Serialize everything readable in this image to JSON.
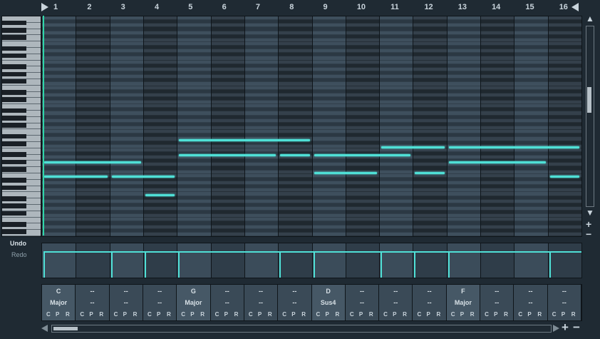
{
  "colors": {
    "accent": "#4fe0d6",
    "background": "#1f2a33",
    "text": "#c9d4dc"
  },
  "ruler": {
    "bars": [
      "1",
      "2",
      "3",
      "4",
      "5",
      "6",
      "7",
      "8",
      "9",
      "10",
      "11",
      "12",
      "13",
      "14",
      "15",
      "16"
    ],
    "start_marker_icon": "play-right-triangle-icon",
    "end_marker_icon": "play-left-triangle-icon"
  },
  "history": {
    "undo_label": "Undo",
    "redo_label": "Redo"
  },
  "notes": [
    {
      "bar": 1,
      "length": 3,
      "pitch": 20
    },
    {
      "bar": 1,
      "length": 2,
      "pitch": 16
    },
    {
      "bar": 3,
      "length": 2,
      "pitch": 16
    },
    {
      "bar": 4,
      "length": 1,
      "pitch": 11
    },
    {
      "bar": 5,
      "length": 4,
      "pitch": 26
    },
    {
      "bar": 5,
      "length": 3,
      "pitch": 22
    },
    {
      "bar": 8,
      "length": 1,
      "pitch": 22
    },
    {
      "bar": 9,
      "length": 3,
      "pitch": 22
    },
    {
      "bar": 9,
      "length": 2,
      "pitch": 17
    },
    {
      "bar": 11,
      "length": 2,
      "pitch": 24
    },
    {
      "bar": 12,
      "length": 1,
      "pitch": 17
    },
    {
      "bar": 13,
      "length": 4,
      "pitch": 24
    },
    {
      "bar": 13,
      "length": 3,
      "pitch": 20
    },
    {
      "bar": 16,
      "length": 1,
      "pitch": 16
    }
  ],
  "velocity_lane": {
    "steps": [
      1,
      3,
      4,
      5,
      8,
      9,
      11,
      12,
      13,
      16
    ]
  },
  "chords": [
    {
      "root": "C",
      "type": "Major"
    },
    {
      "root": "--",
      "type": "--"
    },
    {
      "root": "--",
      "type": "--"
    },
    {
      "root": "--",
      "type": "--"
    },
    {
      "root": "G",
      "type": "Major"
    },
    {
      "root": "--",
      "type": "--"
    },
    {
      "root": "--",
      "type": "--"
    },
    {
      "root": "--",
      "type": "--"
    },
    {
      "root": "D",
      "type": "Sus4"
    },
    {
      "root": "--",
      "type": "--"
    },
    {
      "root": "--",
      "type": "--"
    },
    {
      "root": "--",
      "type": "--"
    },
    {
      "root": "F",
      "type": "Major"
    },
    {
      "root": "--",
      "type": "--"
    },
    {
      "root": "--",
      "type": "--"
    },
    {
      "root": "--",
      "type": "--"
    }
  ],
  "chord_buttons": {
    "c": "C",
    "p": "P",
    "r": "R"
  },
  "scrollbar": {
    "up_icon": "triangle-up-icon",
    "down_icon": "triangle-down-icon",
    "zoom_in_label": "+",
    "zoom_out_label": "−",
    "zoom_in_icon": "plus-icon",
    "zoom_out_icon": "minus-icon"
  }
}
